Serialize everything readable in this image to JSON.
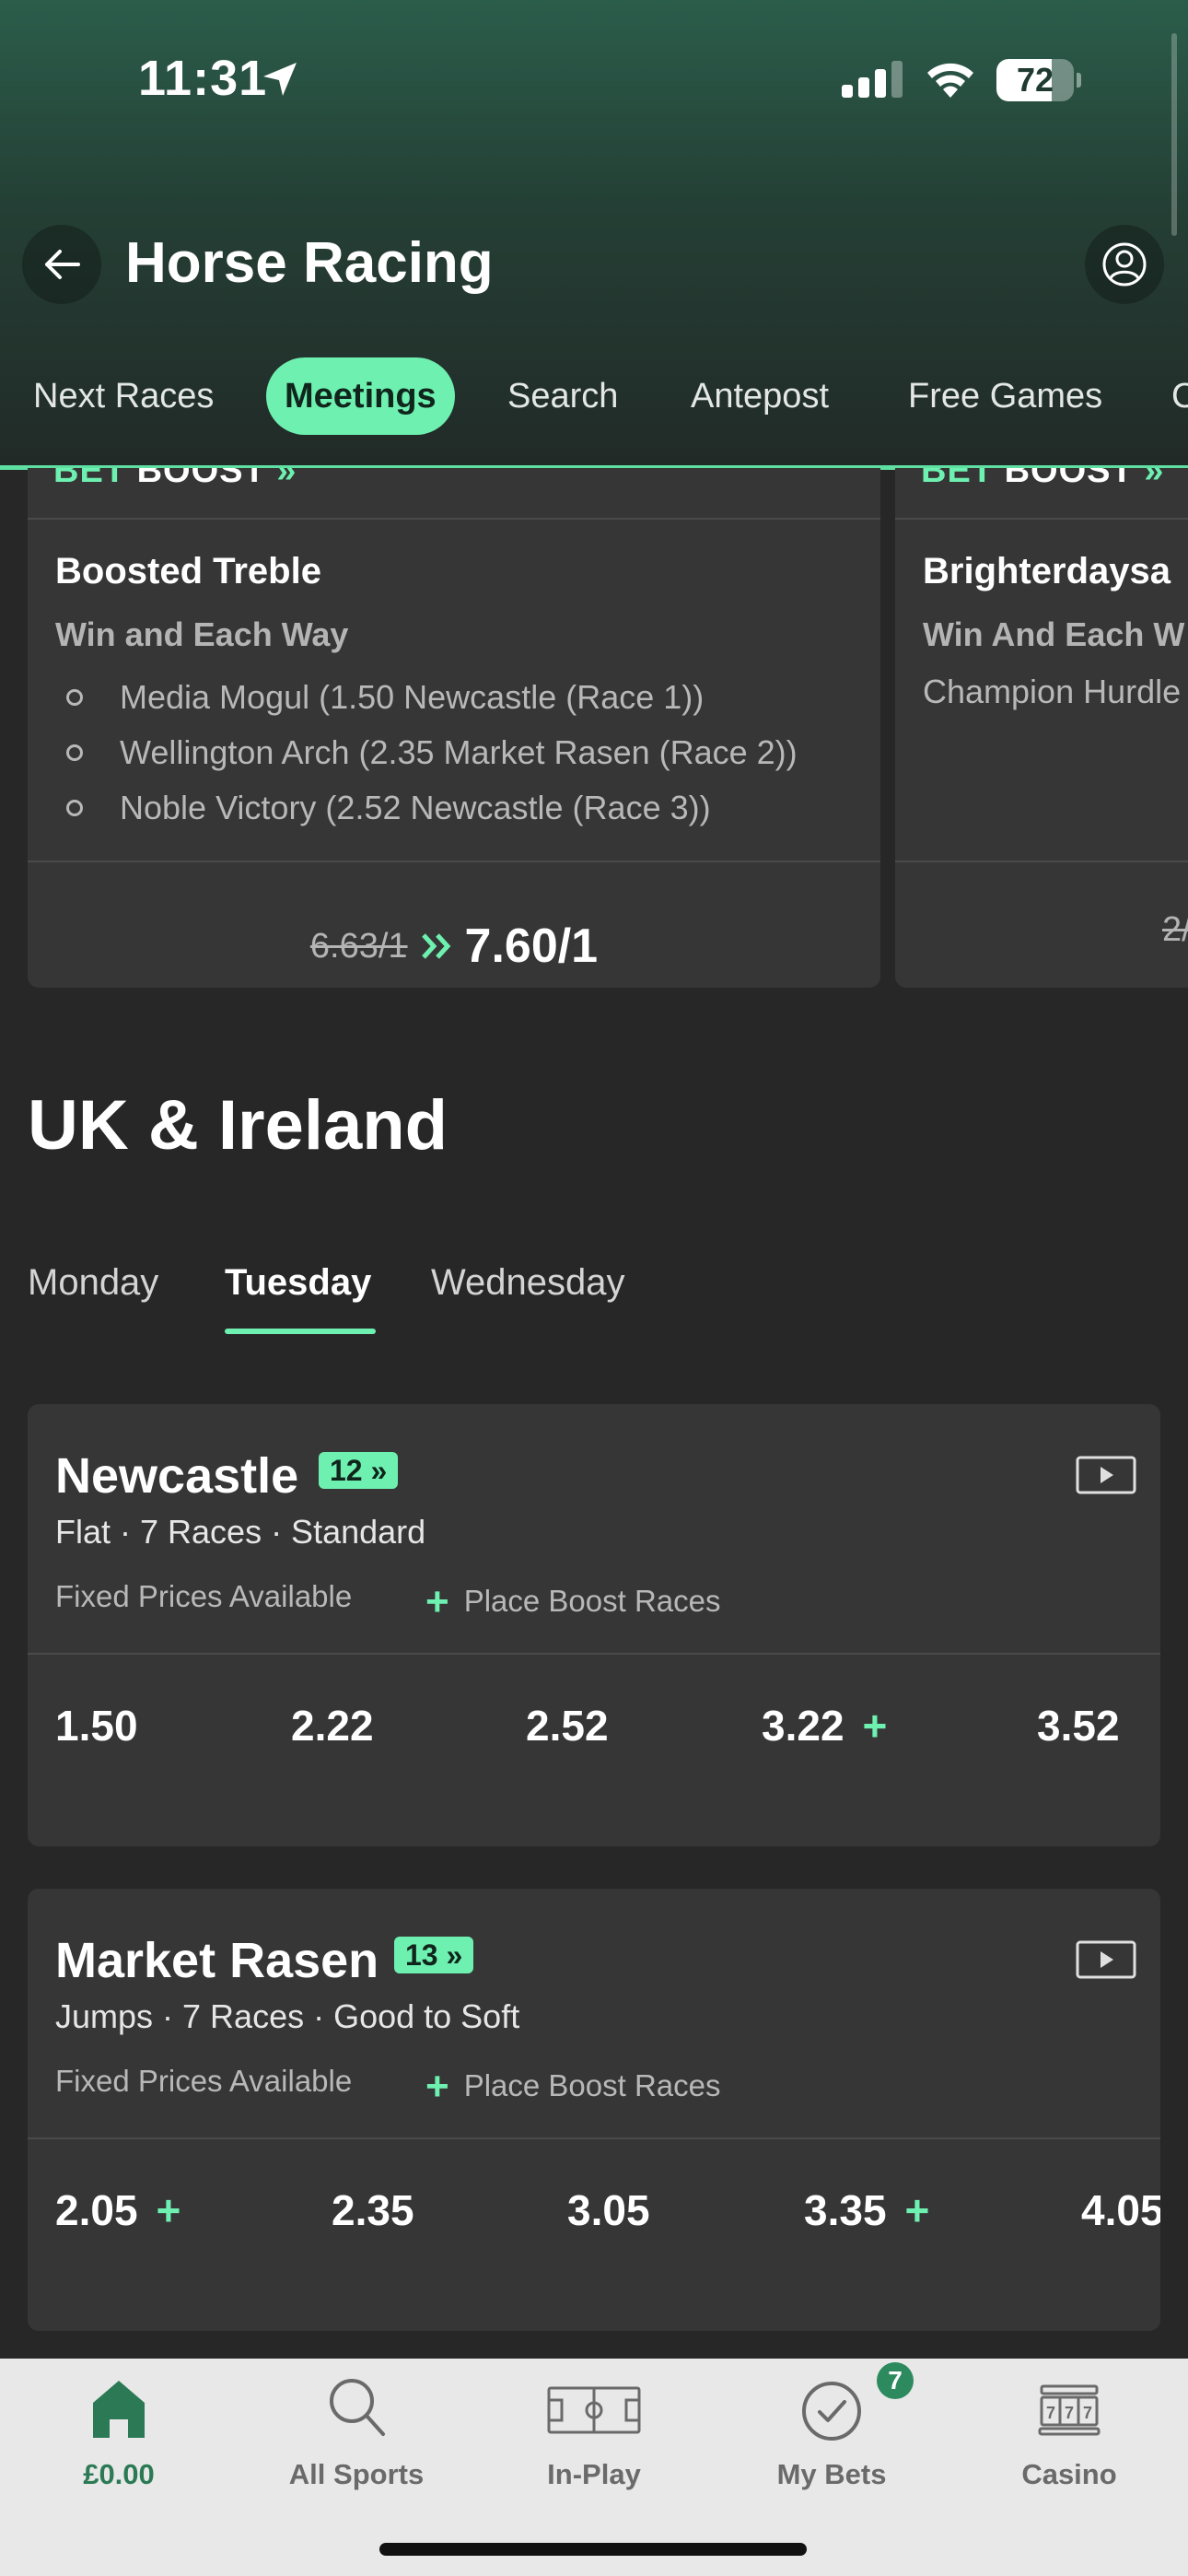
{
  "status_bar": {
    "time": "11:31",
    "battery": "72",
    "battery_level": 0.72
  },
  "header": {
    "title": "Horse Racing"
  },
  "tabs": [
    {
      "label": "Next Races"
    },
    {
      "label": "Meetings"
    },
    {
      "label": "Search"
    },
    {
      "label": "Antepost"
    },
    {
      "label": "Free Games"
    },
    {
      "label": "C"
    }
  ],
  "active_tab": "Meetings",
  "boost_cards": [
    {
      "tag_bet": "BET",
      "tag_boost": "BOOST",
      "title": "Boosted Treble",
      "subtitle": "Win and Each Way",
      "selections": [
        "Media Mogul (1.50 Newcastle (Race 1))",
        "Wellington Arch (2.35 Market Rasen (Race 2))",
        "Noble Victory (2.52 Newcastle (Race 3))"
      ],
      "old_price": "6.63/1",
      "new_price": "7.60/1"
    },
    {
      "tag_bet": "BET",
      "tag_boost": "BOOST",
      "title": "Brighterdaysa",
      "subtitle": "Win And Each W",
      "line": "Champion Hurdle",
      "old_price": "2/"
    }
  ],
  "region": {
    "title": "UK & Ireland"
  },
  "days": [
    {
      "label": "Monday"
    },
    {
      "label": "Tuesday"
    },
    {
      "label": "Wednesday"
    }
  ],
  "active_day": "Tuesday",
  "meetings": [
    {
      "name": "Newcastle",
      "badge": "12",
      "info": "Flat · 7 Races · Standard",
      "fixed_prices": "Fixed Prices Available",
      "place_boost": "Place Boost Races",
      "times": [
        {
          "time": "1.50",
          "boost": false
        },
        {
          "time": "2.22",
          "boost": false
        },
        {
          "time": "2.52",
          "boost": false
        },
        {
          "time": "3.22",
          "boost": true
        },
        {
          "time": "3.52",
          "boost": false
        }
      ]
    },
    {
      "name": "Market Rasen",
      "badge": "13",
      "info": "Jumps · 7 Races · Good to Soft",
      "fixed_prices": "Fixed Prices Available",
      "place_boost": "Place Boost Races",
      "times": [
        {
          "time": "2.05",
          "boost": true
        },
        {
          "time": "2.35",
          "boost": false
        },
        {
          "time": "3.05",
          "boost": false
        },
        {
          "time": "3.35",
          "boost": true
        },
        {
          "time": "4.05",
          "boost": false
        }
      ]
    }
  ],
  "bottom_nav": [
    {
      "label": "£0.00",
      "icon": "home-icon",
      "active": true
    },
    {
      "label": "All Sports",
      "icon": "search-icon"
    },
    {
      "label": "In-Play",
      "icon": "pitch-icon"
    },
    {
      "label": "My Bets",
      "icon": "check-circle-icon",
      "badge": "7"
    },
    {
      "label": "Casino",
      "icon": "slot-machine-icon"
    }
  ],
  "colors": {
    "accent": "#6ef0b0",
    "header": "#2b5d4b",
    "background": "#272727",
    "card": "#363636",
    "nav_active": "#2c7a55"
  }
}
